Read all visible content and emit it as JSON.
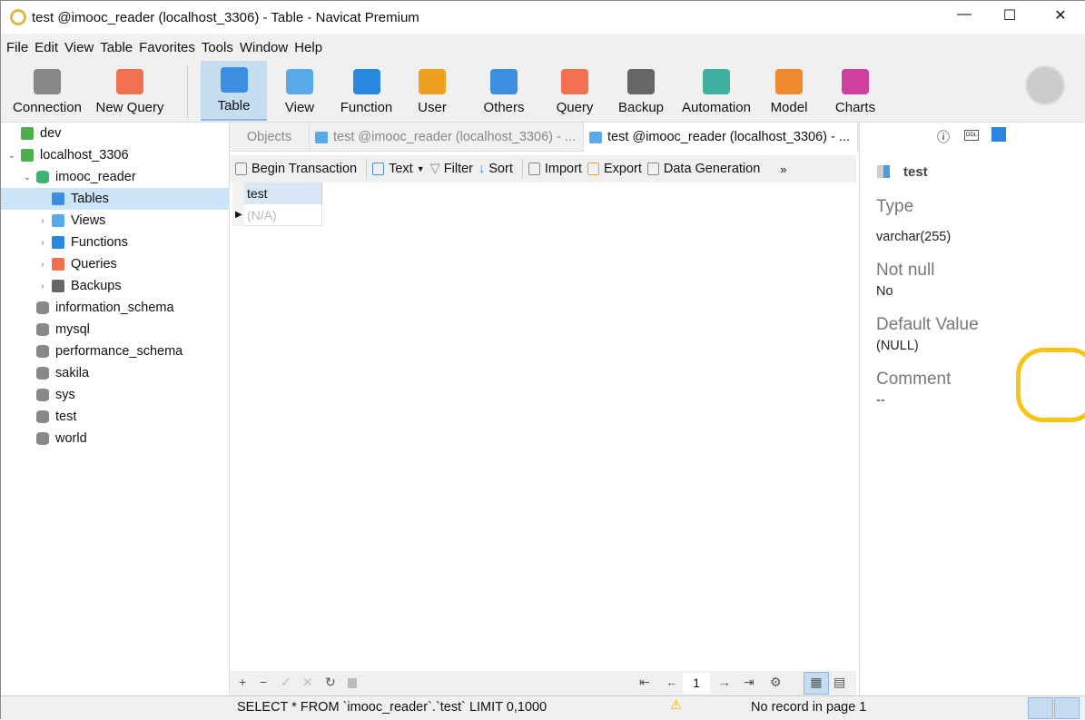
{
  "window": {
    "title": "test @imooc_reader (localhost_3306) - Table - Navicat Premium",
    "min": "—",
    "max": "☐",
    "close": "✕"
  },
  "menu": [
    "File",
    "Edit",
    "View",
    "Table",
    "Favorites",
    "Tools",
    "Window",
    "Help"
  ],
  "toolbar": [
    {
      "label": "Connection",
      "icon": "plug-icon",
      "color": "#888"
    },
    {
      "label": "New Query",
      "icon": "new-query-icon",
      "color": "#f07050"
    },
    {
      "label": "Table",
      "icon": "table-icon",
      "color": "#3b8ee0"
    },
    {
      "label": "View",
      "icon": "view-icon",
      "color": "#5aa9e8"
    },
    {
      "label": "Function",
      "icon": "function-icon",
      "color": "#2a88e0"
    },
    {
      "label": "User",
      "icon": "user-icon",
      "color": "#f0a020"
    },
    {
      "label": "Others",
      "icon": "tools-icon",
      "color": "#3b8ee0"
    },
    {
      "label": "Query",
      "icon": "query-icon",
      "color": "#f07050"
    },
    {
      "label": "Backup",
      "icon": "backup-icon",
      "color": "#666"
    },
    {
      "label": "Automation",
      "icon": "robot-icon",
      "color": "#40b0a0"
    },
    {
      "label": "Model",
      "icon": "model-icon",
      "color": "#f08a30"
    },
    {
      "label": "Charts",
      "icon": "charts-icon",
      "color": "#d040a0"
    }
  ],
  "tree": [
    {
      "label": "dev",
      "level": 0,
      "icon": "connection-icon"
    },
    {
      "label": "localhost_3306",
      "level": 0,
      "icon": "connection-icon",
      "expanded": true
    },
    {
      "label": "imooc_reader",
      "level": 1,
      "icon": "database-icon",
      "expanded": true
    },
    {
      "label": "Tables",
      "level": 2,
      "icon": "tables-icon",
      "selected": true
    },
    {
      "label": "Views",
      "level": 2,
      "icon": "views-icon"
    },
    {
      "label": "Functions",
      "level": 2,
      "icon": "functions-icon"
    },
    {
      "label": "Queries",
      "level": 2,
      "icon": "queries-icon"
    },
    {
      "label": "Backups",
      "level": 2,
      "icon": "backups-icon"
    },
    {
      "label": "information_schema",
      "level": 1,
      "icon": "database-icon"
    },
    {
      "label": "mysql",
      "level": 1,
      "icon": "database-icon"
    },
    {
      "label": "performance_schema",
      "level": 1,
      "icon": "database-icon"
    },
    {
      "label": "sakila",
      "level": 1,
      "icon": "database-icon"
    },
    {
      "label": "sys",
      "level": 1,
      "icon": "database-icon"
    },
    {
      "label": "test",
      "level": 1,
      "icon": "database-icon"
    },
    {
      "label": "world",
      "level": 1,
      "icon": "database-icon"
    }
  ],
  "tabs": [
    "Objects",
    "test @imooc_reader (localhost_3306) - ...",
    "test @imooc_reader (localhost_3306) - ..."
  ],
  "datatoolbar": {
    "begin": "Begin Transaction",
    "text": "Text",
    "filter": "Filter",
    "sort": "Sort",
    "import": "Import",
    "export": "Export",
    "datagen": "Data Generation",
    "more": "»"
  },
  "grid": {
    "columns": [
      "test"
    ],
    "rows": [
      [
        "(N/A)"
      ]
    ]
  },
  "pager": {
    "page": "1"
  },
  "status": {
    "sql": "SELECT * FROM `imooc_reader`.`test` LIMIT 0,1000",
    "records": "No record in page 1"
  },
  "panel": {
    "field": "test",
    "type_label": "Type",
    "type": "varchar(255)",
    "notnull_label": "Not null",
    "notnull": "No",
    "default_label": "Default Value",
    "default": "(NULL)",
    "comment_label": "Comment",
    "comment": "--",
    "ddl": "DDL"
  }
}
